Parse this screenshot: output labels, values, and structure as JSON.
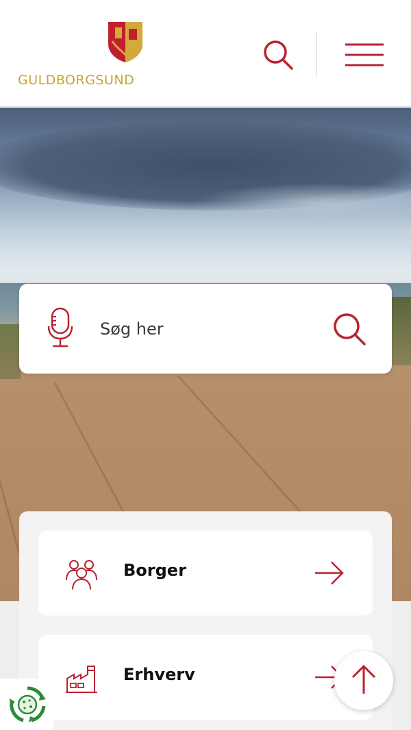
{
  "header": {
    "logo_text": "GULDBORGSUND",
    "search_icon": "search-icon",
    "menu_icon": "hamburger-menu-icon"
  },
  "search": {
    "placeholder": "Søg her",
    "mic_icon": "microphone-icon",
    "submit_icon": "search-icon"
  },
  "nav": {
    "items": [
      {
        "label": "Borger",
        "icon": "people-icon",
        "arrow": "arrow-right-icon"
      },
      {
        "label": "Erhverv",
        "icon": "factory-icon",
        "arrow": "arrow-right-icon"
      }
    ]
  },
  "floating": {
    "cookie_icon": "cookie-consent-icon",
    "scroll_top_icon": "arrow-up-icon"
  },
  "colors": {
    "brand_red": "#b8232f",
    "brand_gold": "#c9a233",
    "cookie_green": "#2e8b3a"
  }
}
